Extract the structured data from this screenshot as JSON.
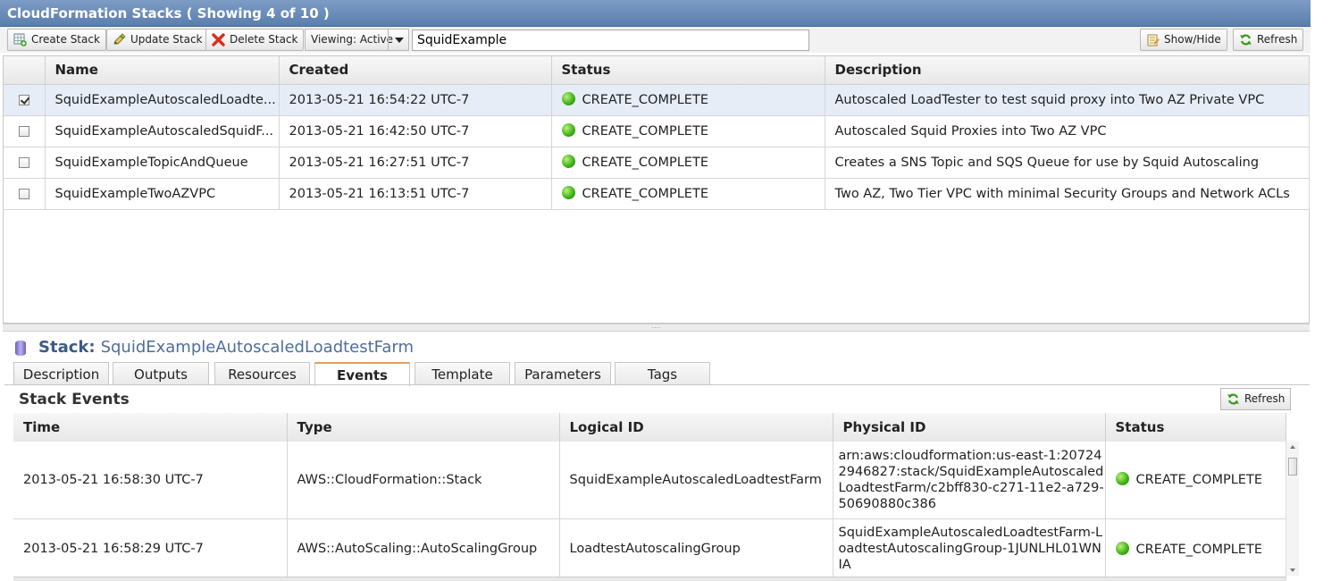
{
  "window": {
    "title": "CloudFormation Stacks ( Showing 4 of 10 )"
  },
  "toolbar": {
    "create_label": "Create Stack",
    "update_label": "Update Stack",
    "delete_label": "Delete Stack",
    "viewing_label": "Viewing: Active",
    "search_value": "SquidExample",
    "showhide_label": "Show/Hide",
    "refresh_label": "Refresh"
  },
  "stacks": {
    "headers": [
      "Name",
      "Created",
      "Status",
      "Description"
    ],
    "rows": [
      {
        "checked": true,
        "name": "SquidExampleAutoscaledLoadte...",
        "created": "2013-05-21 16:54:22 UTC-7",
        "status": "CREATE_COMPLETE",
        "description": "Autoscaled LoadTester to test squid proxy into Two AZ Private VPC"
      },
      {
        "checked": false,
        "name": "SquidExampleAutoscaledSquidF...",
        "created": "2013-05-21 16:42:50 UTC-7",
        "status": "CREATE_COMPLETE",
        "description": "Autoscaled Squid Proxies into Two AZ VPC"
      },
      {
        "checked": false,
        "name": "SquidExampleTopicAndQueue",
        "created": "2013-05-21 16:27:51 UTC-7",
        "status": "CREATE_COMPLETE",
        "description": "Creates a SNS Topic and SQS Queue for use by Squid Autoscaling"
      },
      {
        "checked": false,
        "name": "SquidExampleTwoAZVPC",
        "created": "2013-05-21 16:13:51 UTC-7",
        "status": "CREATE_COMPLETE",
        "description": "Two AZ, Two Tier VPC with minimal Security Groups and Network ACLs"
      }
    ]
  },
  "detail": {
    "stack_label": "Stack:",
    "stack_name": "SquidExampleAutoscaledLoadtestFarm",
    "tabs": [
      "Description",
      "Outputs",
      "Resources",
      "Events",
      "Template",
      "Parameters",
      "Tags"
    ],
    "active_tab": "Events",
    "events_title": "Stack Events",
    "refresh_label": "Refresh",
    "events_headers": [
      "Time",
      "Type",
      "Logical ID",
      "Physical ID",
      "Status"
    ],
    "events": [
      {
        "time": "2013-05-21 16:58:30 UTC-7",
        "type": "AWS::CloudFormation::Stack",
        "logical_id": "SquidExampleAutoscaledLoadtestFarm",
        "physical_id": "arn:aws:cloudformation:us-east-1:207242946827:stack/SquidExampleAutoscaledLoadtestFarm/c2bff830-c271-11e2-a729-50690880c386",
        "status": "CREATE_COMPLETE"
      },
      {
        "time": "2013-05-21 16:58:29 UTC-7",
        "type": "AWS::AutoScaling::AutoScalingGroup",
        "logical_id": "LoadtestAutoscalingGroup",
        "physical_id": "SquidExampleAutoscaledLoadtestFarm-LoadtestAutoscalingGroup-1JUNLHL01WNIA",
        "status": "CREATE_COMPLETE"
      }
    ]
  },
  "colors": {
    "titlebar": "#6a8bb8",
    "status_ok": "#3cae16",
    "selected_row": "#e6edf7",
    "active_tab_accent": "#e2a05a",
    "stack_name": "#4e6d9c"
  },
  "icons": {
    "create": "grid-add-icon",
    "update": "pencil-icon",
    "delete": "red-x-icon",
    "showhide": "notepad-icon",
    "refresh": "green-arrows-icon",
    "stack": "database-icon"
  }
}
